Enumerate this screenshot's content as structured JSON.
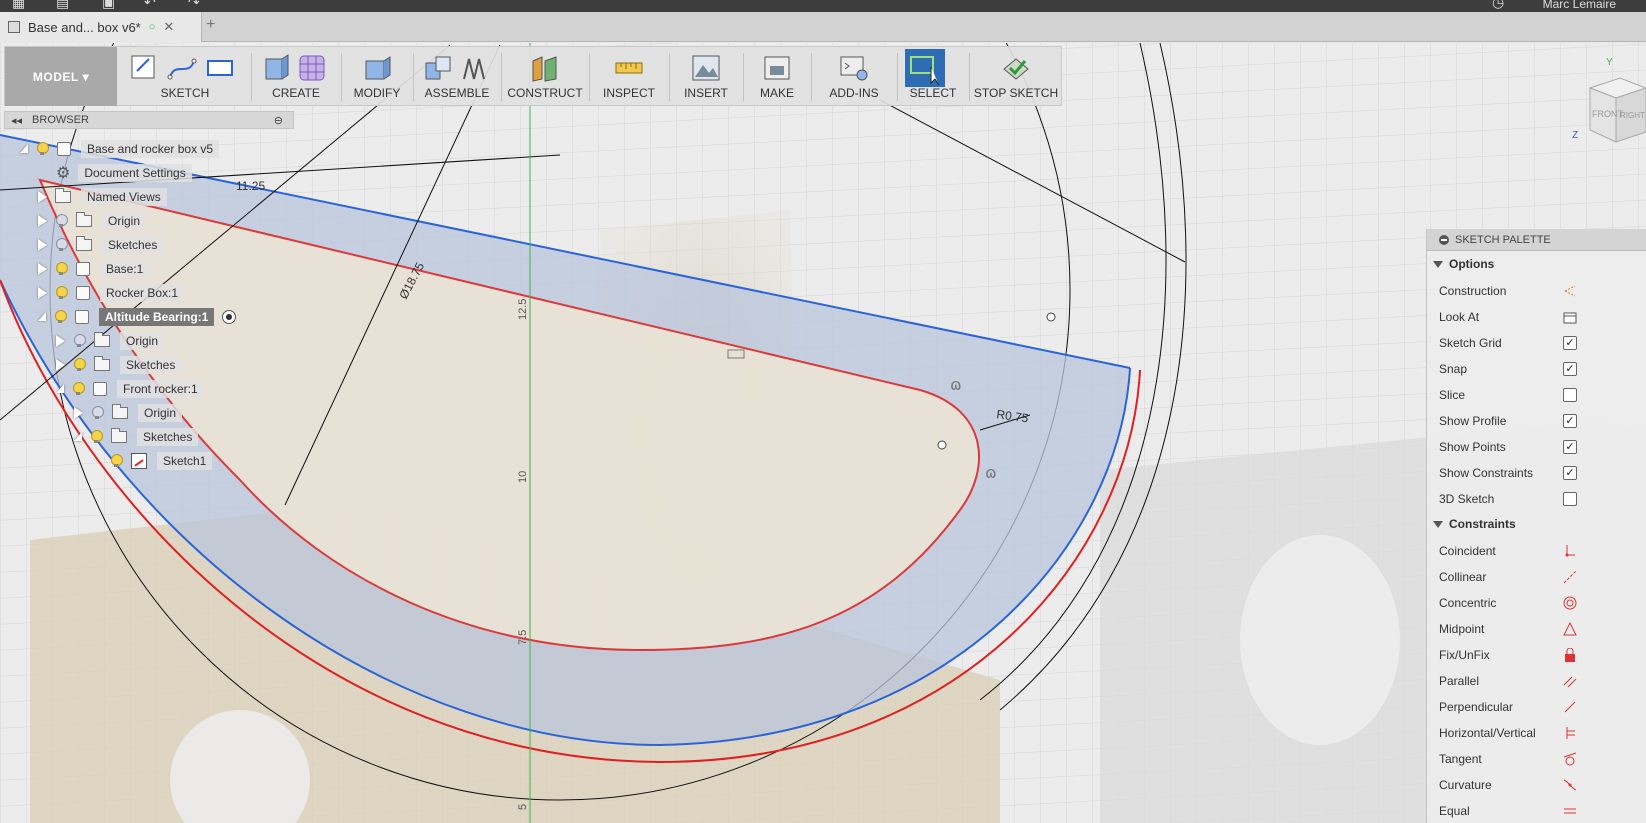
{
  "app": {
    "user_name": "Marc Lemaire",
    "document_tab": "Base and... box v6*",
    "tab_close": "✕",
    "tab_new": "+"
  },
  "toolbar": {
    "workspace": "MODEL",
    "groups": [
      {
        "label": "SKETCH"
      },
      {
        "label": "CREATE"
      },
      {
        "label": "MODIFY"
      },
      {
        "label": "ASSEMBLE"
      },
      {
        "label": "CONSTRUCT"
      },
      {
        "label": "INSPECT"
      },
      {
        "label": "INSERT"
      },
      {
        "label": "MAKE"
      },
      {
        "label": "ADD-INS"
      },
      {
        "label": "SELECT"
      },
      {
        "label": "STOP SKETCH"
      }
    ]
  },
  "browser": {
    "title": "BROWSER",
    "items": [
      {
        "label": "Base and rocker box v5",
        "icon": "component-icon"
      },
      {
        "label": "Document Settings",
        "icon": "gear-icon"
      },
      {
        "label": "Named Views",
        "icon": "folder-icon"
      },
      {
        "label": "Origin",
        "icon": "folder-icon"
      },
      {
        "label": "Sketches",
        "icon": "folder-icon"
      },
      {
        "label": "Base:1",
        "icon": "component-icon"
      },
      {
        "label": "Rocker Box:1",
        "icon": "component-icon"
      },
      {
        "label": "Altitude Bearing:1",
        "icon": "component-icon"
      },
      {
        "label": "Origin",
        "icon": "folder-icon"
      },
      {
        "label": "Sketches",
        "icon": "folder-icon"
      },
      {
        "label": "Front rocker:1",
        "icon": "component-icon"
      },
      {
        "label": "Origin",
        "icon": "folder-icon"
      },
      {
        "label": "Sketches",
        "icon": "folder-icon"
      },
      {
        "label": "Sketch1",
        "icon": "sketch-icon"
      }
    ]
  },
  "viewcube": {
    "front": "FRONT",
    "right": "RIGHT",
    "axis_y": "Y",
    "axis_z": "Z"
  },
  "dimensions": {
    "d1": "11.25",
    "d2": "Ø18.75",
    "d3": "R0.75",
    "ruler_125": "12.5",
    "ruler_10": "10",
    "ruler_75": "7.5",
    "ruler_5": "5"
  },
  "palette": {
    "title": "SKETCH PALETTE",
    "options_title": "Options",
    "options": [
      {
        "label": "Construction",
        "kind": "icon",
        "icon": "construction-icon"
      },
      {
        "label": "Look At",
        "kind": "icon",
        "icon": "look-at-icon"
      },
      {
        "label": "Sketch Grid",
        "kind": "checkbox",
        "checked": "✓"
      },
      {
        "label": "Snap",
        "kind": "checkbox",
        "checked": "✓"
      },
      {
        "label": "Slice",
        "kind": "checkbox",
        "checked": ""
      },
      {
        "label": "Show Profile",
        "kind": "checkbox",
        "checked": "✓"
      },
      {
        "label": "Show Points",
        "kind": "checkbox",
        "checked": "✓"
      },
      {
        "label": "Show Constraints",
        "kind": "checkbox",
        "checked": "✓"
      },
      {
        "label": "3D Sketch",
        "kind": "checkbox",
        "checked": ""
      }
    ],
    "constraints_title": "Constraints",
    "constraints": [
      {
        "label": "Coincident",
        "icon": "coincident-icon"
      },
      {
        "label": "Collinear",
        "icon": "collinear-icon"
      },
      {
        "label": "Concentric",
        "icon": "concentric-icon"
      },
      {
        "label": "Midpoint",
        "icon": "midpoint-icon"
      },
      {
        "label": "Fix/UnFix",
        "icon": "lock-icon"
      },
      {
        "label": "Parallel",
        "icon": "parallel-icon"
      },
      {
        "label": "Perpendicular",
        "icon": "perpendicular-icon"
      },
      {
        "label": "Horizontal/Vertical",
        "icon": "horizontal-vertical-icon"
      },
      {
        "label": "Tangent",
        "icon": "tangent-icon"
      },
      {
        "label": "Curvature",
        "icon": "curvature-icon"
      },
      {
        "label": "Equal",
        "icon": "equal-icon"
      }
    ]
  },
  "colors": {
    "sketch_red": "#e02020",
    "sketch_blue": "#2a64d8",
    "profile_fill": "#b9c6dc",
    "body_tan": "#d9cdb4",
    "active_node": "#777777"
  }
}
